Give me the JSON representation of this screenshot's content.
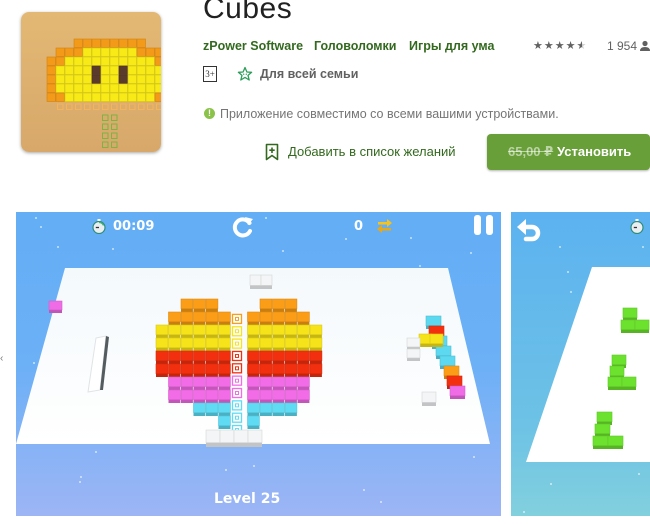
{
  "app": {
    "title": "Cubes",
    "developer": "zPower Software",
    "categories": [
      "Головоломки",
      "Игры для ума"
    ],
    "rating_stars": "★★★★★",
    "rating_value": 4.5,
    "rating_count": "1 954",
    "age_rating": "3+",
    "family_label": "Для всей семьи",
    "compatibility": "Приложение совместимо со всеми вашими устройствами.",
    "wishlist_label": "Добавить в список желаний",
    "old_price": "65,00 ₽",
    "install_label": "Установить",
    "colors": {
      "accent": "#689f38",
      "link": "#33691e"
    }
  },
  "screenshots": [
    {
      "timer": "00:09",
      "moves": "0",
      "level": "Level 25",
      "icons": [
        "stopwatch-icon",
        "restart-icon",
        "swap-icon",
        "pause-icon"
      ]
    },
    {
      "icons": [
        "undo-icon",
        "stopwatch-icon"
      ]
    }
  ],
  "left_edge_mark": "‹"
}
